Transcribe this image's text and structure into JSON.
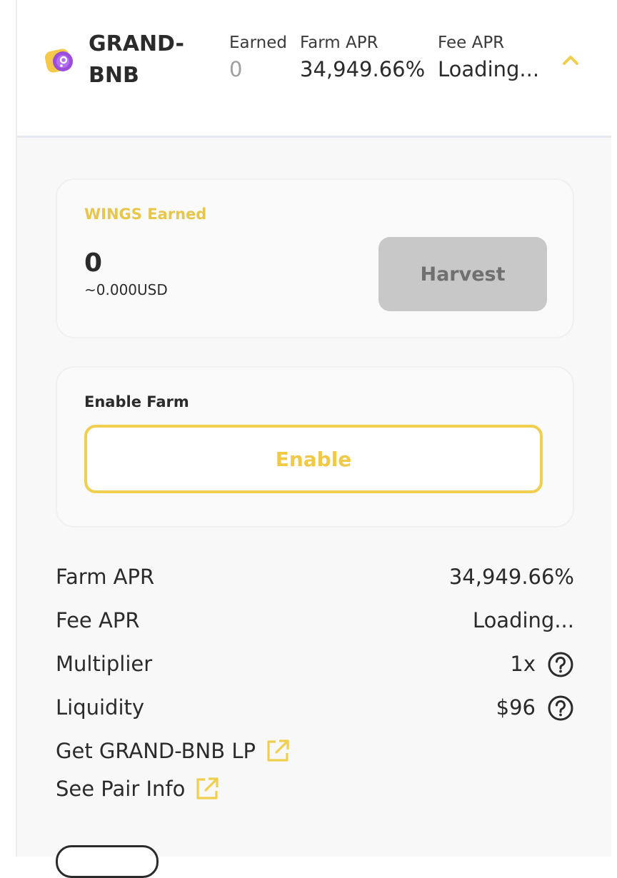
{
  "farm_row": {
    "pair_name": "GRAND-BNB",
    "earned_label": "Earned",
    "earned_value": "0",
    "farm_apr_label": "Farm APR",
    "farm_apr_value": "34,949.66%",
    "fee_apr_label": "Fee APR",
    "fee_apr_value": "Loading..."
  },
  "harvest_box": {
    "label": "WINGS Earned",
    "amount": "0",
    "usd": "~0.000USD",
    "button_label": "Harvest"
  },
  "enable_box": {
    "label": "Enable Farm",
    "button_label": "Enable"
  },
  "details": {
    "farm_apr_label": "Farm APR",
    "farm_apr_value": "34,949.66%",
    "fee_apr_label": "Fee APR",
    "fee_apr_value": "Loading...",
    "multiplier_label": "Multiplier",
    "multiplier_value": "1x",
    "liquidity_label": "Liquidity",
    "liquidity_value": "$96"
  },
  "links": {
    "get_lp": "Get GRAND-BNB LP",
    "pair_info": "See Pair Info"
  },
  "icons": {
    "pair_logo": "token-pair-icon",
    "expand": "chevron-up-icon",
    "help": "question-circle-icon",
    "external": "external-link-icon"
  },
  "colors": {
    "accent_yellow": "#f0cf4f",
    "harvest_disabled": "#c8c8c8",
    "logo_purple": "#9b4ddb"
  }
}
